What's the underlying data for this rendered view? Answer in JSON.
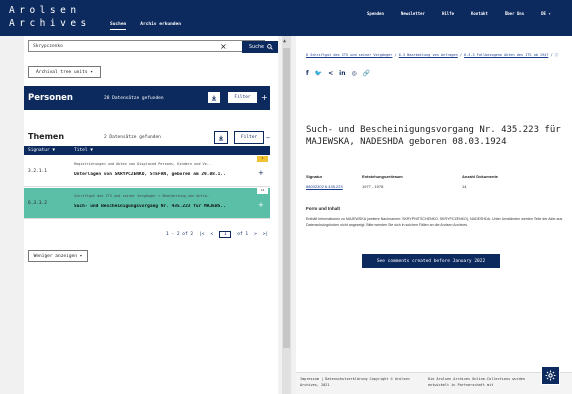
{
  "header": {
    "logo_line1": "Arolsen",
    "logo_line2": "Archives",
    "tabs": [
      {
        "label": "Suchen"
      },
      {
        "label": "Archiv erkunden"
      }
    ],
    "nav": [
      {
        "label": "Spenden"
      },
      {
        "label": "Newsletter"
      },
      {
        "label": "Hilfe"
      },
      {
        "label": "Kontakt"
      },
      {
        "label": "Über Uns"
      },
      {
        "label": "DE ▾"
      }
    ]
  },
  "search": {
    "value": "Skrypczenko",
    "clear": "×",
    "button_label": "Suche",
    "icon": "search-icon"
  },
  "archival_tree_label": "Archival tree units ▾",
  "personen": {
    "title": "Personen",
    "count_label": "28 Datensätze gefunden",
    "filter_label": "Filter",
    "expand": "+"
  },
  "themen": {
    "title": "Themen",
    "count_label": "2 Datensätze gefunden",
    "filter_label": "Filter",
    "collapse": "–",
    "columns": [
      {
        "label": "Signatur ▼"
      },
      {
        "label": "Titel ▼"
      }
    ],
    "rows": [
      {
        "signatur": "3.2.1.1",
        "line1": "Registrierungen und Akten von Displaced Persons, Kindern und Ve..",
        "line2": "Unterlagen von SKRYPCZENKO, STEFAN, geboren am 29.08.1..",
        "flag": "1"
      },
      {
        "signatur": "6.3.3.2",
        "line1": "Schriftgut des ITS und seiner Vorgänger > Bearbeitung von Anfra..",
        "line2": "Such- und Bescheinigungsvorgang Nr. 435.223 für MAJEWS..",
        "flag": "14"
      }
    ],
    "pager": {
      "range": "1 - 2 of 2",
      "page": "1",
      "of": "of 1"
    },
    "less_label": "Weniger anzeigen ▾"
  },
  "detail": {
    "breadcrumb": [
      {
        "label": "6 Schriftgut des ITS und seiner Vorgänger"
      },
      {
        "label": "6.3 Bearbeitung von Anfragen"
      },
      {
        "label": "6.3.3 Fallbezogene Akten des ITS ab 1947"
      }
    ],
    "share_icons": [
      "f",
      "🐦",
      "<",
      "in",
      "◎",
      "🔗"
    ],
    "title": "Such- und Bescheinigungsvorgang Nr. 435.223 für MAJEWSKA, NADESHDA geboren 08.03.1924",
    "meta": {
      "labels": [
        "Signatur",
        "Entstehungszeitraum",
        "Anzahl Dokumente"
      ],
      "values": [
        "88032302 6.435.223",
        "1977 - 1978",
        "14"
      ]
    },
    "form_title": "Form und Inhalt",
    "form_text": "Enthält Informationen zu MAJEWSKA (weitere Nachnamen: SKRYPNITSCHENKO, SKRYPCZENKO), NADESHDA. Unter Umständen werden Teile der Akte aus Datenschutzgründen nicht angezeigt. Bitte wenden Sie sich in solchen Fällen an die Arolsen Archives.",
    "see_comments_label": "See comments created before January 2022"
  },
  "footer": {
    "left": "Impressum | Datenschutzerklärung Copyright © Arolsen Archives, 2021",
    "right": "Die Arolsen Archives Online-Collections wurden entwickelt in Partnerschaft mit"
  },
  "colors": {
    "brand": "#0d2a5e",
    "selected_row": "#5bbfa8"
  }
}
